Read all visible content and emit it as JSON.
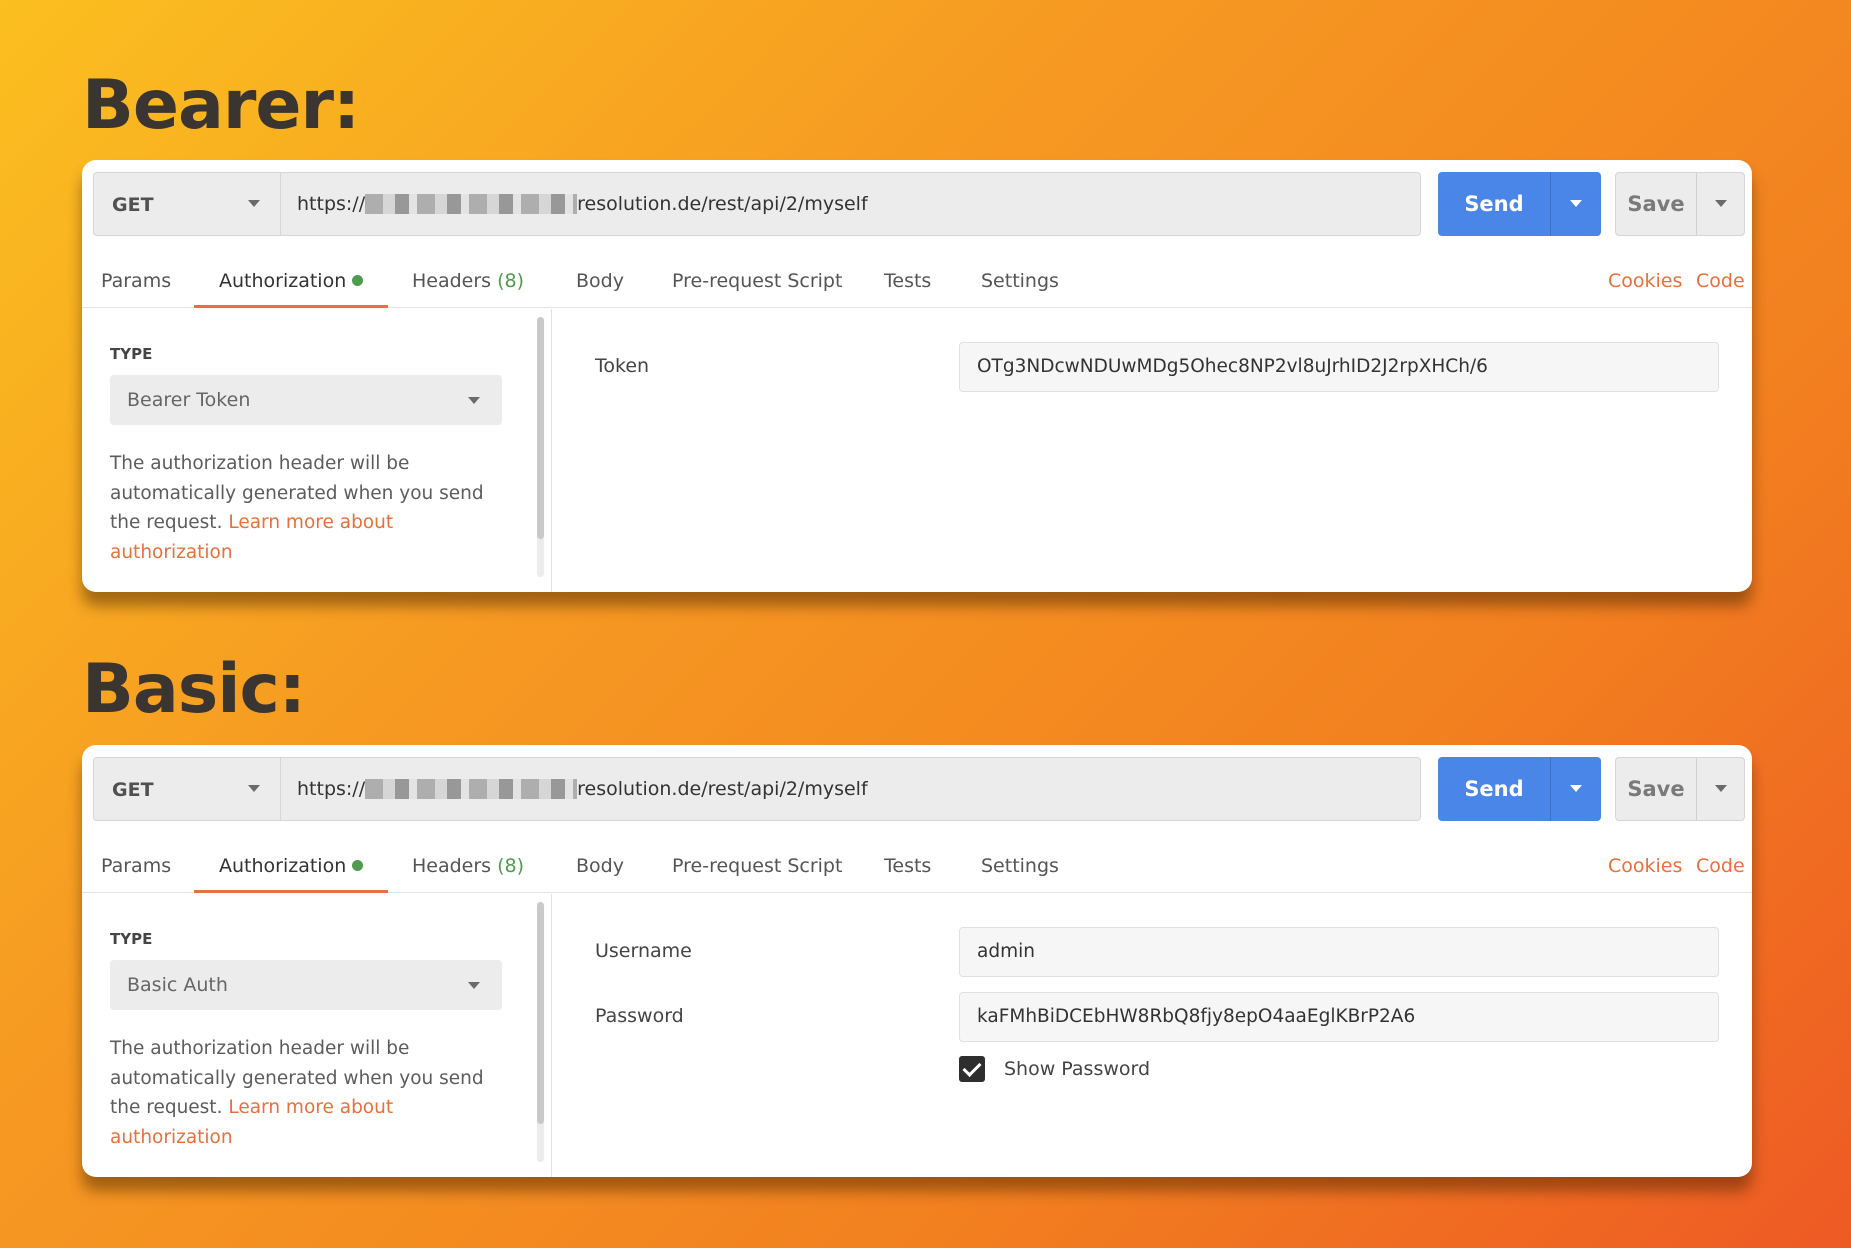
{
  "headings": {
    "bearer": "Bearer:",
    "basic": "Basic:"
  },
  "colors": {
    "accent_orange": "#e8703a",
    "send_blue": "#4a86e8",
    "status_green": "#4f9c4f"
  },
  "bearer_panel": {
    "method": "GET",
    "url_prefix": "https://",
    "url_suffix": "resolution.de/rest/api/2/myself",
    "send": "Send",
    "save": "Save",
    "tabs": {
      "params": "Params",
      "authorization": "Authorization",
      "headers": "Headers",
      "headers_count": "(8)",
      "body": "Body",
      "pre_request": "Pre-request Script",
      "tests": "Tests",
      "settings": "Settings",
      "cookies": "Cookies",
      "code": "Code"
    },
    "type_label": "TYPE",
    "type_value": "Bearer Token",
    "help_text": "The authorization header will be automatically generated when you send the request.",
    "help_link": "Learn more about authorization",
    "token_label": "Token",
    "token_value": "OTg3NDcwNDUwMDg5Ohec8NP2vl8uJrhID2J2rpXHCh/6"
  },
  "basic_panel": {
    "method": "GET",
    "url_prefix": "https://",
    "url_suffix": "resolution.de/rest/api/2/myself",
    "send": "Send",
    "save": "Save",
    "tabs": {
      "params": "Params",
      "authorization": "Authorization",
      "headers": "Headers",
      "headers_count": "(8)",
      "body": "Body",
      "pre_request": "Pre-request Script",
      "tests": "Tests",
      "settings": "Settings",
      "cookies": "Cookies",
      "code": "Code"
    },
    "type_label": "TYPE",
    "type_value": "Basic Auth",
    "help_text": "The authorization header will be automatically generated when you send the request.",
    "help_link": "Learn more about authorization",
    "username_label": "Username",
    "username_value": "admin",
    "password_label": "Password",
    "password_value": "kaFMhBiDCEbHW8RbQ8fjy8epO4aaEglKBrP2A6",
    "show_password_label": "Show Password",
    "show_password_checked": "true"
  }
}
